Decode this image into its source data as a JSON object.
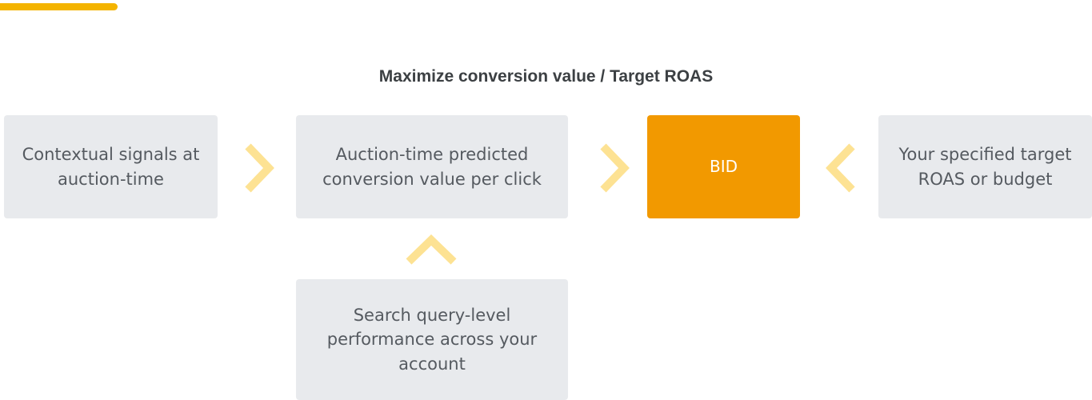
{
  "colors": {
    "accent_bar": "#f4b400",
    "box_gray": "#e8eaed",
    "bid_box": "#f29900",
    "chevron": "#fde293",
    "title_text": "#3c4043",
    "box_text": "#555a60"
  },
  "diagram": {
    "title": "Maximize conversion value / Target ROAS",
    "nodes": {
      "contextual": "Contextual signals at auction-time",
      "predicted": "Auction-time predicted conversion value per click",
      "bid": "BID",
      "target": "Your specified target ROAS or budget",
      "query": "Search query-level performance across your account"
    },
    "edges": [
      {
        "from": "contextual",
        "to": "predicted",
        "icon": "chevron-right-icon"
      },
      {
        "from": "predicted",
        "to": "bid",
        "icon": "chevron-right-icon"
      },
      {
        "from": "target",
        "to": "bid",
        "icon": "chevron-left-icon"
      },
      {
        "from": "query",
        "to": "predicted",
        "icon": "chevron-up-icon"
      }
    ]
  }
}
